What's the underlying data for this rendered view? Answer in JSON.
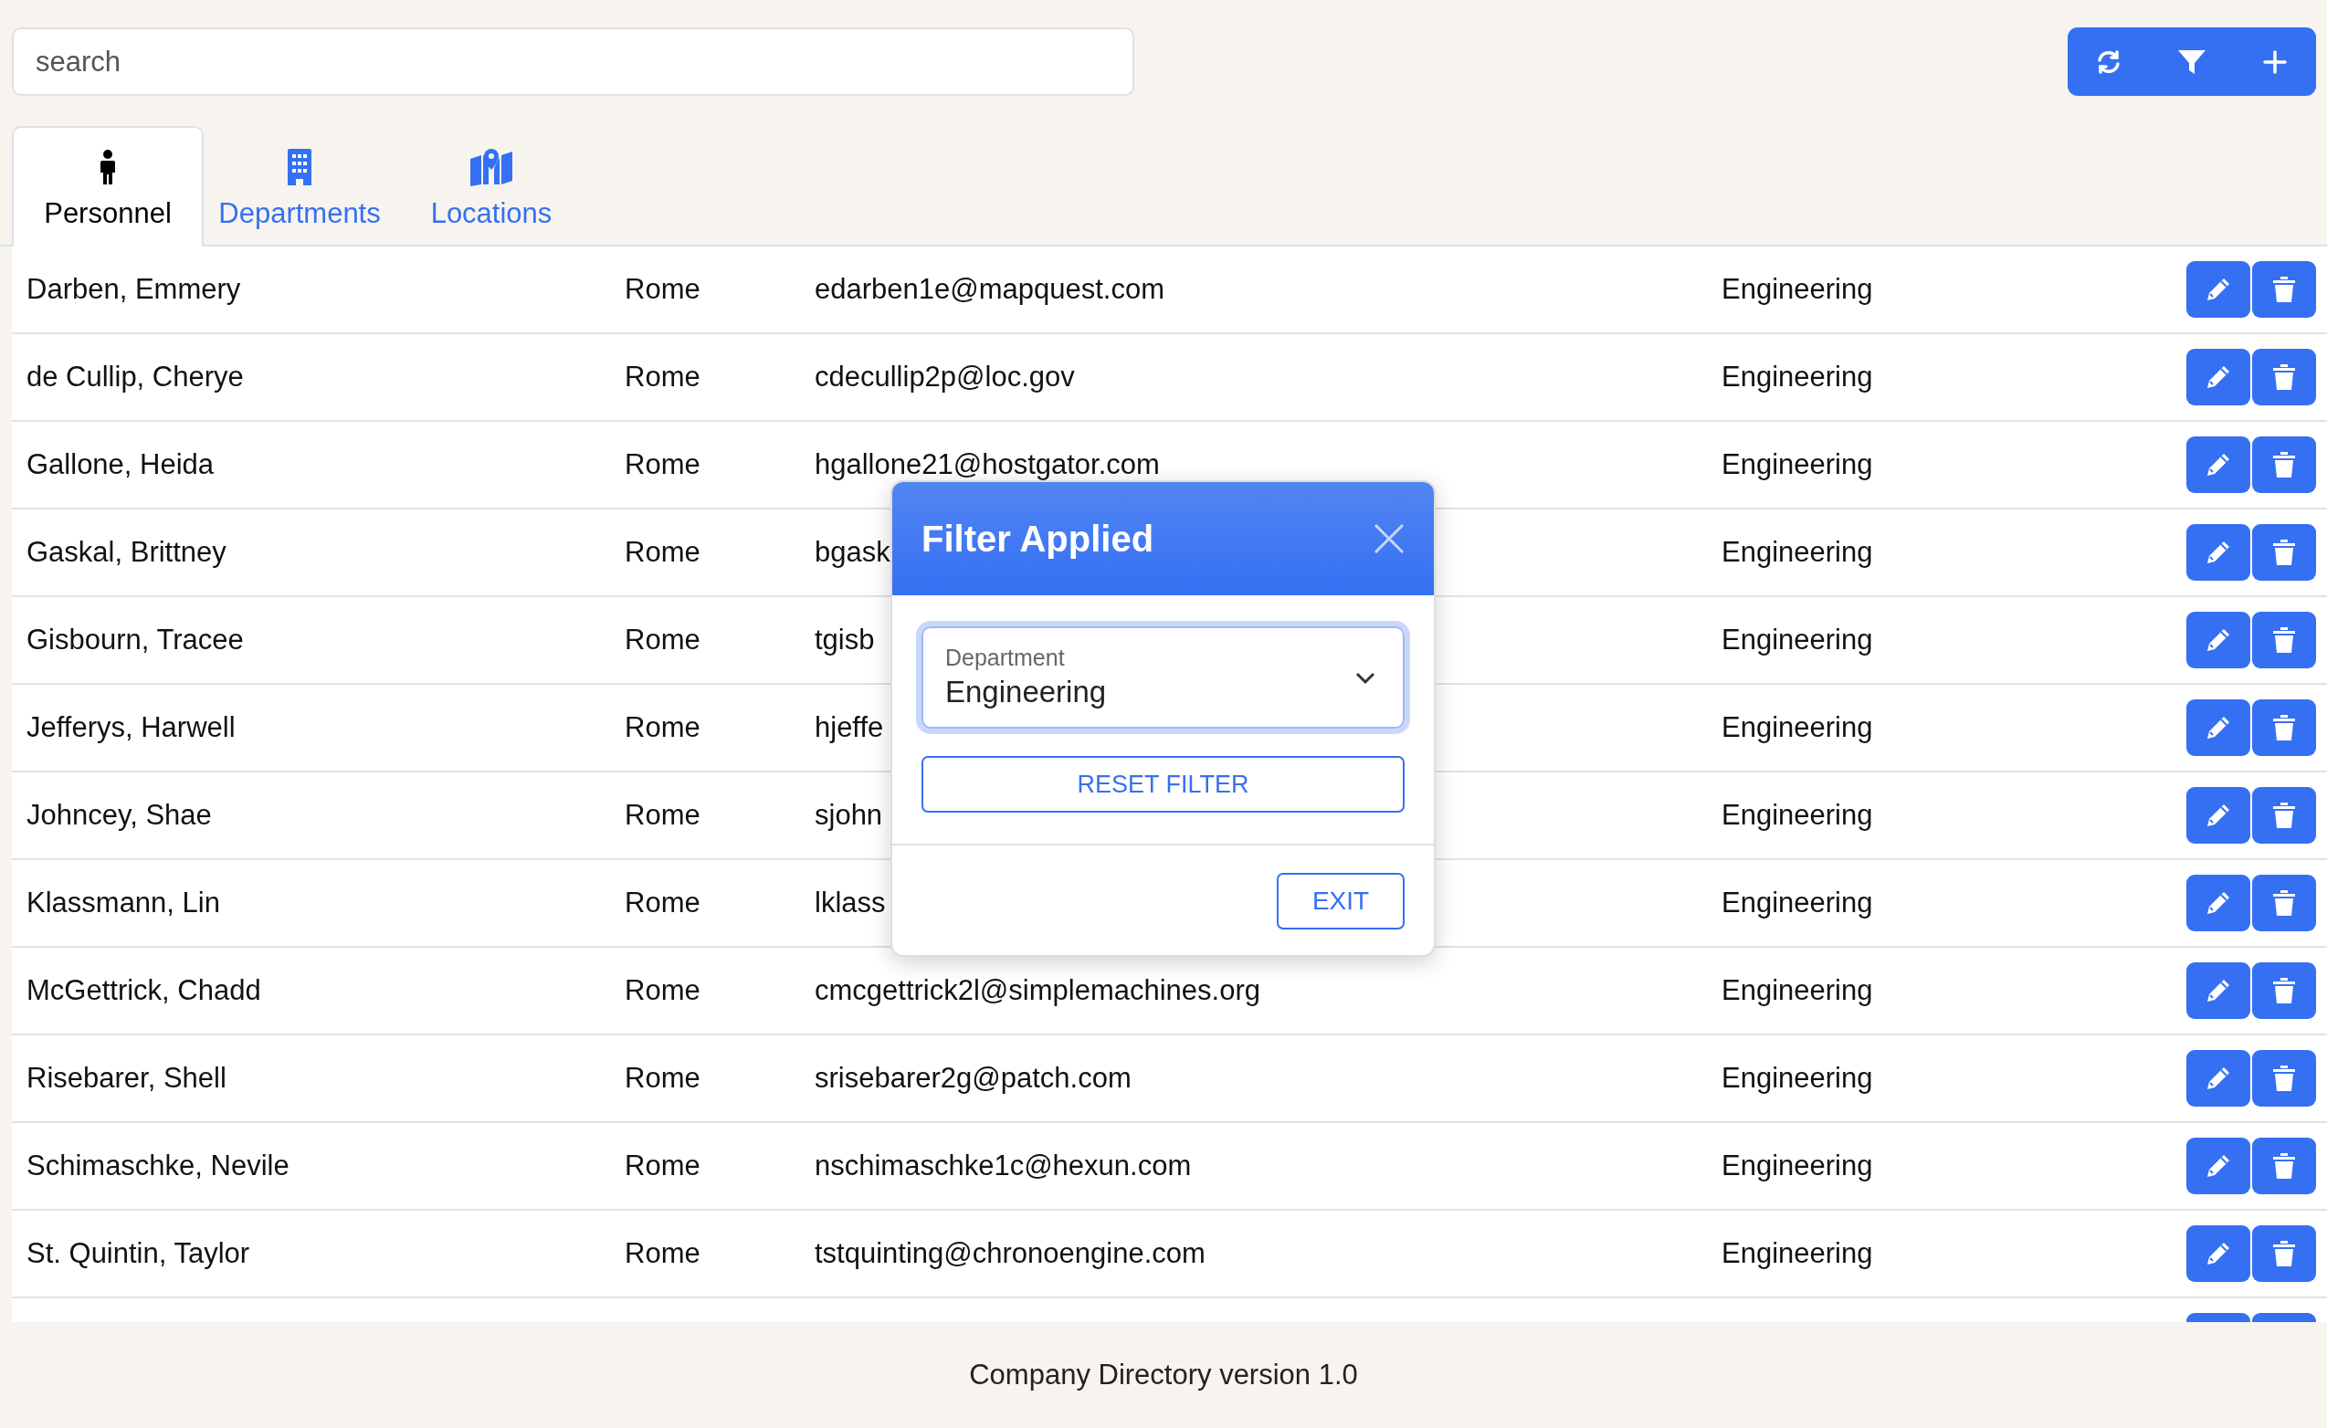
{
  "search": {
    "placeholder": "search"
  },
  "toolbar": [
    {
      "kind": "refresh"
    },
    {
      "kind": "filter"
    },
    {
      "kind": "add"
    }
  ],
  "tabs": [
    {
      "label": "Personnel",
      "kind": "person",
      "selected": true
    },
    {
      "label": "Departments",
      "kind": "building",
      "selected": false
    },
    {
      "label": "Locations",
      "kind": "map",
      "selected": false
    }
  ],
  "table": {
    "rows": [
      {
        "name": "Darben, Emmery",
        "location": "Rome",
        "email": "edarben1e@mapquest.com",
        "department": "Engineering"
      },
      {
        "name": "de Cullip, Cherye",
        "location": "Rome",
        "email": "cdecullip2p@loc.gov",
        "department": "Engineering"
      },
      {
        "name": "Gallone, Heida",
        "location": "Rome",
        "email": "hgallone21@hostgator.com",
        "department": "Engineering"
      },
      {
        "name": "Gaskal, Brittney",
        "location": "Rome",
        "email": "bgask",
        "department": "Engineering"
      },
      {
        "name": "Gisbourn, Tracee",
        "location": "Rome",
        "email": "tgisb",
        "department": "Engineering"
      },
      {
        "name": "Jefferys, Harwell",
        "location": "Rome",
        "email": "hjeffe",
        "department": "Engineering"
      },
      {
        "name": "Johncey, Shae",
        "location": "Rome",
        "email": "sjohn",
        "department": "Engineering"
      },
      {
        "name": "Klassmann, Lin",
        "location": "Rome",
        "email": "lklass",
        "department": "Engineering"
      },
      {
        "name": "McGettrick, Chadd",
        "location": "Rome",
        "email": "cmcgettrick2l@simplemachines.org",
        "department": "Engineering"
      },
      {
        "name": "Risebarer, Shell",
        "location": "Rome",
        "email": "srisebarer2g@patch.com",
        "department": "Engineering"
      },
      {
        "name": "Schimaschke, Nevile",
        "location": "Rome",
        "email": "nschimaschke1c@hexun.com",
        "department": "Engineering"
      },
      {
        "name": "St. Quintin, Taylor",
        "location": "Rome",
        "email": "tstquinting@chronoengine.com",
        "department": "Engineering"
      }
    ],
    "clipped_row": {
      "buttons_visible": true
    }
  },
  "modal": {
    "title": "Filter Applied",
    "select": {
      "label": "Department",
      "value": "Engineering"
    },
    "reset_button": "RESET FILTER",
    "exit_button": "EXIT"
  },
  "footer": "Company Directory version 1.0"
}
